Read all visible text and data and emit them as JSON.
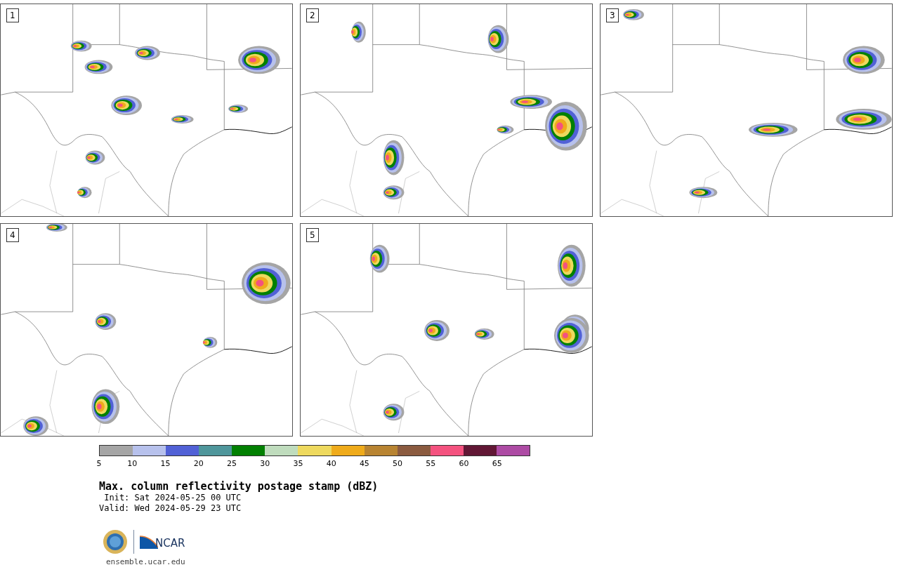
{
  "panels": [
    {
      "label": "1"
    },
    {
      "label": "2"
    },
    {
      "label": "3"
    },
    {
      "label": "4"
    },
    {
      "label": "5"
    }
  ],
  "colorbar": {
    "segments": [
      {
        "color": "#a5a5a5",
        "tick": "5"
      },
      {
        "color": "#b7c1ec",
        "tick": "10"
      },
      {
        "color": "#5161d6",
        "tick": "15"
      },
      {
        "color": "#4f969b",
        "tick": "20"
      },
      {
        "color": "#028002",
        "tick": "25"
      },
      {
        "color": "#bfdcbd",
        "tick": "30"
      },
      {
        "color": "#eed95e",
        "tick": "35"
      },
      {
        "color": "#efab1b",
        "tick": "40"
      },
      {
        "color": "#b88432",
        "tick": "45"
      },
      {
        "color": "#8b5b40",
        "tick": "50"
      },
      {
        "color": "#f4527f",
        "tick": "55"
      },
      {
        "color": "#611735",
        "tick": "60"
      },
      {
        "color": "#ad4ba4",
        "tick": "65"
      }
    ]
  },
  "title": "Max. column reflectivity postage stamp (dBZ)",
  "init": " Init: Sat 2024-05-25 00 UTC",
  "valid": "Valid: Wed 2024-05-29 23 UTC",
  "footer": {
    "logo_text": "NCAR",
    "url": "ensemble.ucar.edu"
  }
}
